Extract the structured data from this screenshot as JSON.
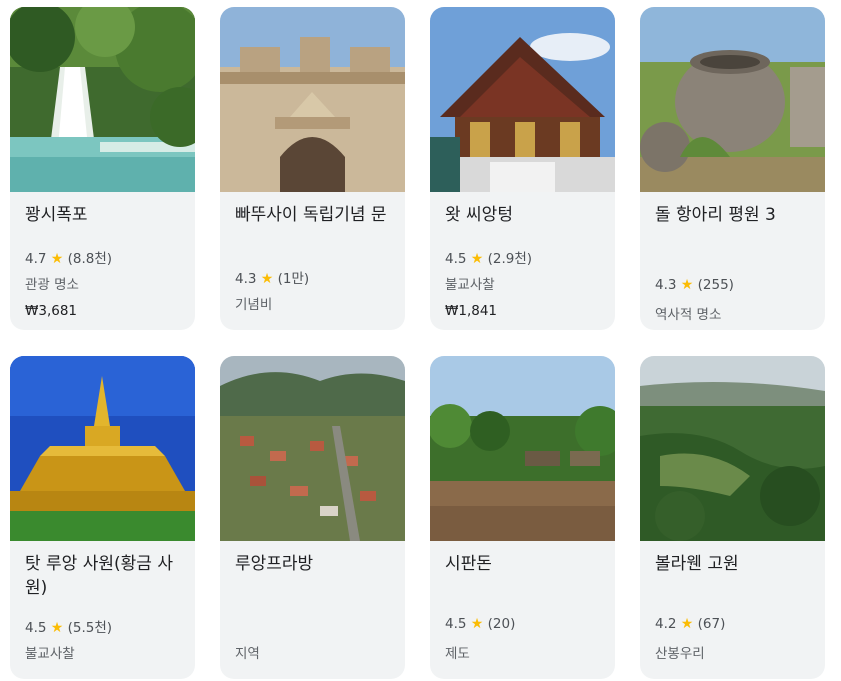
{
  "places": [
    {
      "name": "꽝시폭포",
      "rating": "4.7",
      "reviews": "(8.8천)",
      "category": "관광 명소",
      "price": "₩3,681",
      "star": "★"
    },
    {
      "name": "빠뚜사이 독립기념 문",
      "rating": "4.3",
      "reviews": "(1만)",
      "category": "기념비",
      "price": "",
      "star": "★"
    },
    {
      "name": "왓 씨앙텅",
      "rating": "4.5",
      "reviews": "(2.9천)",
      "category": "불교사찰",
      "price": "₩1,841",
      "star": "★"
    },
    {
      "name": "돌 항아리 평원 3",
      "rating": "4.3",
      "reviews": "(255)",
      "category": "역사적 명소",
      "price": "",
      "star": "★"
    },
    {
      "name": "탓 루앙 사원(황금 사원)",
      "rating": "4.5",
      "reviews": "(5.5천)",
      "category": "불교사찰",
      "price": "",
      "star": "★"
    },
    {
      "name": "루앙프라방",
      "rating": "",
      "reviews": "",
      "category": "지역",
      "price": "",
      "star": ""
    },
    {
      "name": "시판돈",
      "rating": "4.5",
      "reviews": "(20)",
      "category": "제도",
      "price": "",
      "star": "★"
    },
    {
      "name": "볼라웬 고원",
      "rating": "4.2",
      "reviews": "(67)",
      "category": "산봉우리",
      "price": "",
      "star": "★"
    }
  ]
}
